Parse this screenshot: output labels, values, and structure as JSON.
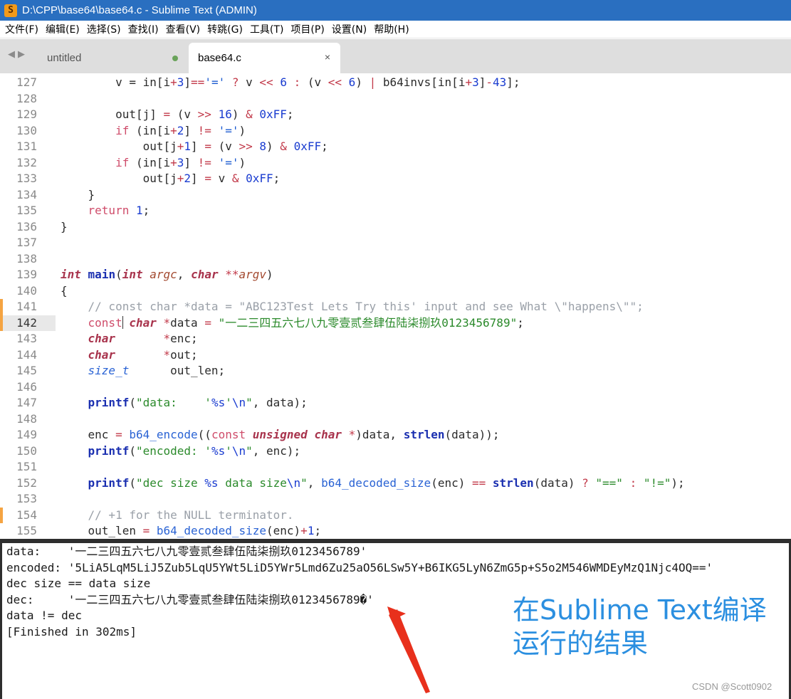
{
  "window": {
    "title": "D:\\CPP\\base64\\base64.c - Sublime Text (ADMIN)",
    "icon": "sublime-text-icon",
    "accent_color": "#2a6fc0"
  },
  "menu": [
    "文件(F)",
    "编辑(E)",
    "选择(S)",
    "查找(I)",
    "查看(V)",
    "转跳(G)",
    "工具(T)",
    "项目(P)",
    "设置(N)",
    "帮助(H)"
  ],
  "tabs": [
    {
      "label": "untitled",
      "active": false,
      "dirty": true
    },
    {
      "label": "base64.c",
      "active": true,
      "close": "×"
    }
  ],
  "nav": {
    "back": "◀",
    "forward": "▶"
  },
  "editor": {
    "current_line": 142,
    "modified_lines": [
      141,
      142,
      154
    ],
    "lines": [
      {
        "n": 127,
        "code": [
          [
            "",
            "        v = in[i"
          ],
          [
            "op",
            "+"
          ],
          [
            "num",
            "3"
          ],
          [
            "",
            "]"
          ],
          [
            "op",
            "=="
          ],
          [
            "sstr",
            "'='"
          ],
          [
            "",
            " "
          ],
          [
            "op",
            "?"
          ],
          [
            "",
            " v "
          ],
          [
            "op",
            "<<"
          ],
          [
            "",
            " "
          ],
          [
            "num",
            "6"
          ],
          [
            "",
            " "
          ],
          [
            "op",
            ":"
          ],
          [
            "",
            " (v "
          ],
          [
            "op",
            "<<"
          ],
          [
            "",
            " "
          ],
          [
            "num",
            "6"
          ],
          [
            "",
            ") "
          ],
          [
            "op",
            "|"
          ],
          [
            "",
            " b64invs[in[i"
          ],
          [
            "op",
            "+"
          ],
          [
            "num",
            "3"
          ],
          [
            "",
            "]"
          ],
          [
            "op",
            "-"
          ],
          [
            "num",
            "43"
          ],
          [
            "",
            "];"
          ]
        ]
      },
      {
        "n": 128,
        "code": []
      },
      {
        "n": 129,
        "code": [
          [
            "",
            "        out[j] "
          ],
          [
            "op",
            "="
          ],
          [
            "",
            " (v "
          ],
          [
            "op",
            ">>"
          ],
          [
            "",
            " "
          ],
          [
            "num",
            "16"
          ],
          [
            "",
            ") "
          ],
          [
            "op",
            "&"
          ],
          [
            "",
            " "
          ],
          [
            "num",
            "0xFF"
          ],
          [
            "",
            ";"
          ]
        ]
      },
      {
        "n": 130,
        "code": [
          [
            "",
            "        "
          ],
          [
            "kw",
            "if"
          ],
          [
            "",
            " (in[i"
          ],
          [
            "op",
            "+"
          ],
          [
            "num",
            "2"
          ],
          [
            "",
            "] "
          ],
          [
            "op",
            "!="
          ],
          [
            "",
            " "
          ],
          [
            "sstr",
            "'='"
          ],
          [
            "",
            ")"
          ]
        ]
      },
      {
        "n": 131,
        "code": [
          [
            "",
            "            out[j"
          ],
          [
            "op",
            "+"
          ],
          [
            "num",
            "1"
          ],
          [
            "",
            "] "
          ],
          [
            "op",
            "="
          ],
          [
            "",
            " (v "
          ],
          [
            "op",
            ">>"
          ],
          [
            "",
            " "
          ],
          [
            "num",
            "8"
          ],
          [
            "",
            ") "
          ],
          [
            "op",
            "&"
          ],
          [
            "",
            " "
          ],
          [
            "num",
            "0xFF"
          ],
          [
            "",
            ";"
          ]
        ]
      },
      {
        "n": 132,
        "code": [
          [
            "",
            "        "
          ],
          [
            "kw",
            "if"
          ],
          [
            "",
            " (in[i"
          ],
          [
            "op",
            "+"
          ],
          [
            "num",
            "3"
          ],
          [
            "",
            "] "
          ],
          [
            "op",
            "!="
          ],
          [
            "",
            " "
          ],
          [
            "sstr",
            "'='"
          ],
          [
            "",
            ")"
          ]
        ]
      },
      {
        "n": 133,
        "code": [
          [
            "",
            "            out[j"
          ],
          [
            "op",
            "+"
          ],
          [
            "num",
            "2"
          ],
          [
            "",
            "] "
          ],
          [
            "op",
            "="
          ],
          [
            "",
            " v "
          ],
          [
            "op",
            "&"
          ],
          [
            "",
            " "
          ],
          [
            "num",
            "0xFF"
          ],
          [
            "",
            ";"
          ]
        ]
      },
      {
        "n": 134,
        "code": [
          [
            "",
            "    }"
          ]
        ]
      },
      {
        "n": 135,
        "code": [
          [
            "",
            "    "
          ],
          [
            "kw",
            "return"
          ],
          [
            "",
            " "
          ],
          [
            "num",
            "1"
          ],
          [
            "",
            ";"
          ]
        ]
      },
      {
        "n": 136,
        "code": [
          [
            "",
            "}"
          ]
        ]
      },
      {
        "n": 137,
        "code": []
      },
      {
        "n": 138,
        "code": []
      },
      {
        "n": 139,
        "code": [
          [
            "type",
            "int"
          ],
          [
            "",
            " "
          ],
          [
            "fn",
            "main"
          ],
          [
            "",
            "("
          ],
          [
            "type",
            "int"
          ],
          [
            "",
            " "
          ],
          [
            "arg",
            "argc"
          ],
          [
            "",
            ", "
          ],
          [
            "type",
            "char"
          ],
          [
            "",
            " "
          ],
          [
            "op",
            "**"
          ],
          [
            "arg",
            "argv"
          ],
          [
            "",
            ")"
          ]
        ]
      },
      {
        "n": 140,
        "code": [
          [
            "",
            "{"
          ]
        ]
      },
      {
        "n": 141,
        "code": [
          [
            "",
            "    "
          ],
          [
            "cmt",
            "// const char *data = \"ABC123Test Lets Try this' input and see What \\\"happens\\\"\";"
          ]
        ]
      },
      {
        "n": 142,
        "code": [
          [
            "",
            "    "
          ],
          [
            "kw",
            "const"
          ],
          [
            "caret",
            ""
          ],
          [
            "",
            " "
          ],
          [
            "type",
            "char"
          ],
          [
            "",
            " "
          ],
          [
            "op",
            "*"
          ],
          [
            "",
            "data "
          ],
          [
            "op",
            "="
          ],
          [
            "",
            " "
          ],
          [
            "str",
            "\"一二三四五六七八九零壹贰叁肆伍陆柒捌玖0123456789\""
          ],
          [
            "",
            ";"
          ]
        ]
      },
      {
        "n": 143,
        "code": [
          [
            "",
            "    "
          ],
          [
            "type",
            "char"
          ],
          [
            "",
            "       "
          ],
          [
            "op",
            "*"
          ],
          [
            "",
            "enc;"
          ]
        ]
      },
      {
        "n": 144,
        "code": [
          [
            "",
            "    "
          ],
          [
            "type",
            "char"
          ],
          [
            "",
            "       "
          ],
          [
            "op",
            "*"
          ],
          [
            "",
            "out;"
          ]
        ]
      },
      {
        "n": 145,
        "code": [
          [
            "",
            "    "
          ],
          [
            "ctype",
            "size_t"
          ],
          [
            "",
            "      out_len;"
          ]
        ]
      },
      {
        "n": 146,
        "code": []
      },
      {
        "n": 147,
        "code": [
          [
            "",
            "    "
          ],
          [
            "fn",
            "printf"
          ],
          [
            "",
            "("
          ],
          [
            "str",
            "\"data:    '"
          ],
          [
            "esc",
            "%s"
          ],
          [
            "str",
            "'"
          ],
          [
            "esc",
            "\\n"
          ],
          [
            "str",
            "\""
          ],
          [
            "",
            ", data);"
          ]
        ]
      },
      {
        "n": 148,
        "code": []
      },
      {
        "n": 149,
        "code": [
          [
            "",
            "    enc "
          ],
          [
            "op",
            "="
          ],
          [
            "",
            " "
          ],
          [
            "call",
            "b64_encode"
          ],
          [
            "",
            "(("
          ],
          [
            "kw",
            "const"
          ],
          [
            "",
            " "
          ],
          [
            "type",
            "unsigned"
          ],
          [
            "",
            " "
          ],
          [
            "type",
            "char"
          ],
          [
            "",
            " "
          ],
          [
            "op",
            "*"
          ],
          [
            "",
            ")data, "
          ],
          [
            "fn",
            "strlen"
          ],
          [
            "",
            "(data));"
          ]
        ]
      },
      {
        "n": 150,
        "code": [
          [
            "",
            "    "
          ],
          [
            "fn",
            "printf"
          ],
          [
            "",
            "("
          ],
          [
            "str",
            "\"encoded: '"
          ],
          [
            "esc",
            "%s"
          ],
          [
            "str",
            "'"
          ],
          [
            "esc",
            "\\n"
          ],
          [
            "str",
            "\""
          ],
          [
            "",
            ", enc);"
          ]
        ]
      },
      {
        "n": 151,
        "code": []
      },
      {
        "n": 152,
        "code": [
          [
            "",
            "    "
          ],
          [
            "fn",
            "printf"
          ],
          [
            "",
            "("
          ],
          [
            "str",
            "\"dec size "
          ],
          [
            "esc",
            "%s"
          ],
          [
            "str",
            " data size"
          ],
          [
            "esc",
            "\\n"
          ],
          [
            "str",
            "\""
          ],
          [
            "",
            ", "
          ],
          [
            "call",
            "b64_decoded_size"
          ],
          [
            "",
            "(enc) "
          ],
          [
            "op",
            "=="
          ],
          [
            "",
            " "
          ],
          [
            "fn",
            "strlen"
          ],
          [
            "",
            "(data) "
          ],
          [
            "op",
            "?"
          ],
          [
            "",
            " "
          ],
          [
            "str",
            "\"==\""
          ],
          [
            "",
            " "
          ],
          [
            "op",
            ":"
          ],
          [
            "",
            " "
          ],
          [
            "str",
            "\"!=\""
          ],
          [
            "",
            ");"
          ]
        ]
      },
      {
        "n": 153,
        "code": []
      },
      {
        "n": 154,
        "code": [
          [
            "",
            "    "
          ],
          [
            "cmt",
            "// +1 for the NULL terminator."
          ]
        ]
      },
      {
        "n": 155,
        "code": [
          [
            "",
            "    out_len "
          ],
          [
            "op",
            "="
          ],
          [
            "",
            " "
          ],
          [
            "call",
            "b64_decoded_size"
          ],
          [
            "",
            "(enc)"
          ],
          [
            "op",
            "+"
          ],
          [
            "num",
            "1"
          ],
          [
            "",
            ";"
          ]
        ]
      }
    ]
  },
  "output": {
    "lines": [
      "data:    '一二三四五六七八九零壹贰叁肆伍陆柒捌玖0123456789'",
      "encoded: '5LiA5LqM5LiJ5Zub5LqU5YWt5LiD5YWr5Lmd6Zu25aO56LSw5Y+B6IKG5LyN6ZmG5p+S5o2M546WMDEyMzQ1Njc4OQ=='",
      "dec size == data size",
      "dec:     '一二三四五六七八九零壹贰叁肆伍陆柒捌玖0123456789�'",
      "data != dec",
      "[Finished in 302ms]"
    ]
  },
  "annotation": {
    "line1": "在Sublime Text编译",
    "line2": "运行的结果",
    "color": "#2b8fe0",
    "arrow_color": "#e8301c"
  },
  "watermark": "CSDN @Scott0902"
}
